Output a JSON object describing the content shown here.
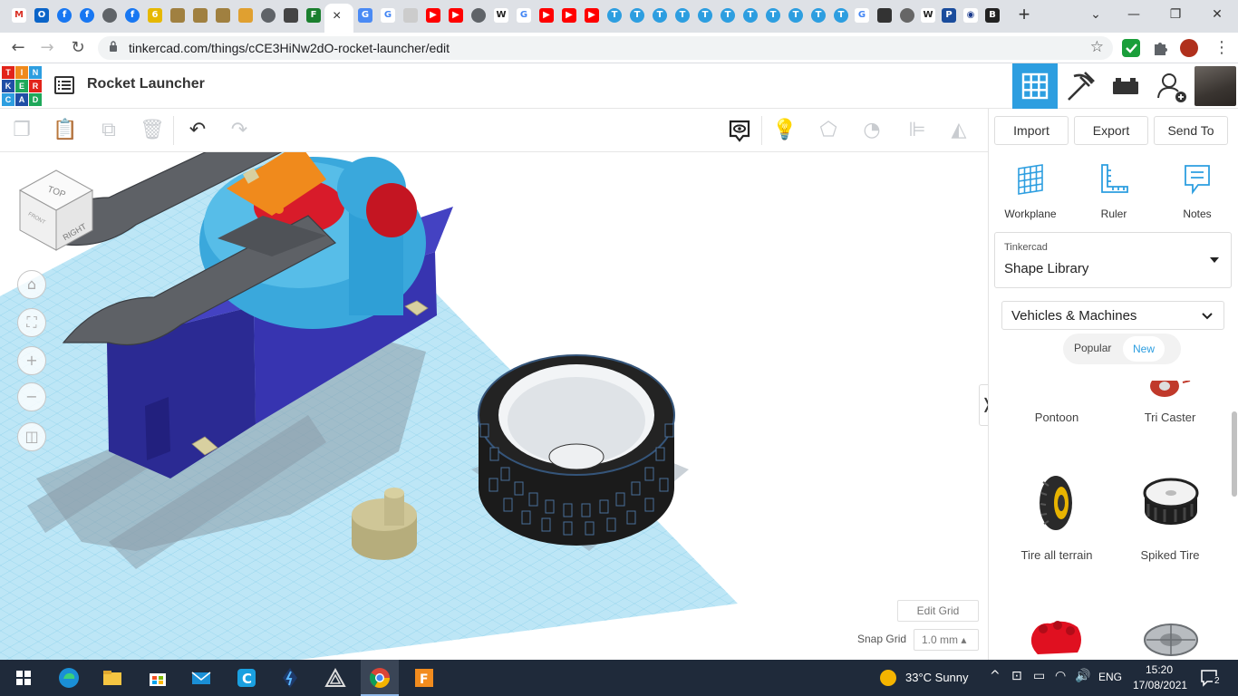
{
  "browser": {
    "active_tab_close": "×",
    "new_tab": "+",
    "url": "tinkercad.com/things/cCE3HiNw2dO-rocket-launcher/edit"
  },
  "tinkercad": {
    "logo_letters": [
      "T",
      "I",
      "N",
      "K",
      "E",
      "R",
      "C",
      "A",
      "D"
    ],
    "title": "Rocket Launcher"
  },
  "panel": {
    "import": "Import",
    "export": "Export",
    "send_to": "Send To",
    "tools": [
      "Workplane",
      "Ruler",
      "Notes"
    ],
    "library_owner": "Tinkercad",
    "library_name": "Shape Library",
    "category": "Vehicles & Machines",
    "tab_popular": "Popular",
    "tab_new": "New",
    "shapes": [
      "Pontoon",
      "Tri Caster",
      "Tire all terrain",
      "Spiked Tire"
    ]
  },
  "canvas": {
    "viewcube_top": "TOP",
    "viewcube_right": "RIGHT",
    "viewcube_front": "FRONT",
    "edit_grid": "Edit Grid",
    "snap_grid_label": "Snap Grid",
    "snap_grid_value": "1.0 mm ▴"
  },
  "taskbar": {
    "weather": "33°C  Sunny",
    "lang": "ENG",
    "time": "15:20",
    "date": "17/08/2021",
    "notifications": "2"
  },
  "colors": {
    "accent": "#2d9ee0",
    "grid": "#a9ddf2",
    "base": "#2f2c9c",
    "dome": "#3aa8dc",
    "rocket": "#5e6166",
    "red": "#d81b2a",
    "orange": "#f08a1c",
    "tan": "#c2b98a",
    "tire": "#1b1b1b"
  }
}
